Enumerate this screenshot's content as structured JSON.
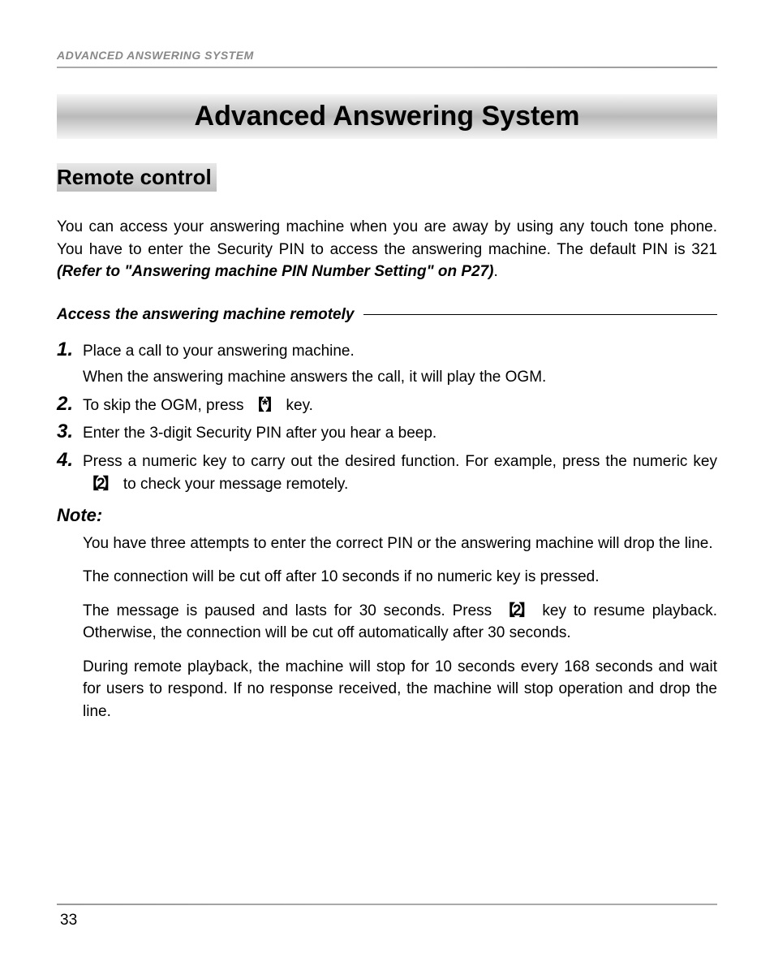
{
  "header": {
    "breadcrumb": "ADVANCED ANSWERING SYSTEM"
  },
  "title": "Advanced Answering System",
  "section": {
    "heading": "Remote control",
    "intro_prefix": "You can access your answering machine when you are away by using any touch tone phone. You have to enter the Security PIN to access the answering machine. The default PIN is 321 ",
    "intro_ref": "(Refer to \"Answering machine PIN Number Setting\" on P27)",
    "intro_suffix": "."
  },
  "sub": {
    "title": "Access the answering machine remotely"
  },
  "steps": {
    "n1": "1.",
    "s1a": "Place a call to your answering machine.",
    "s1b": "When the answering machine answers the call, it will play the OGM.",
    "n2": "2.",
    "s2_pre": "To skip the OGM, press ",
    "s2_key": "*",
    "s2_post": " key.",
    "n3": "3.",
    "s3": "Enter the 3-digit Security PIN after you hear a beep.",
    "n4": "4.",
    "s4_pre": "Press a numeric key to carry out the desired function. For example, press the numeric key ",
    "s4_key": "2",
    "s4_post": " to check your message remotely."
  },
  "note": {
    "label": "Note:",
    "i1": "You have three attempts to enter the correct PIN or the answering machine will drop the line.",
    "i2": "The connection will be cut off after 10 seconds if no numeric key is pressed.",
    "i3_pre": "The message is paused and lasts for 30 seconds. Press ",
    "i3_key": "2",
    "i3_post": " key to resume playback. Otherwise, the connection will be cut off automatically after 30 seconds.",
    "i4": "During remote playback, the machine will stop for 10 seconds every 168 seconds and wait for users to respond. If no response received, the machine will stop operation and drop the line."
  },
  "page_number": "33"
}
